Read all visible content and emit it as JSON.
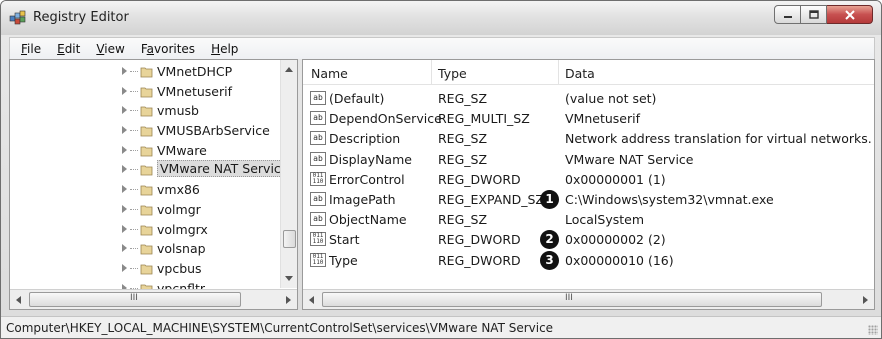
{
  "window": {
    "title": "Registry Editor",
    "icon": "registry-editor-icon",
    "buttons": {
      "minimize": "minimize-icon",
      "maximize": "maximize-icon",
      "close": "close-icon"
    }
  },
  "menu": [
    {
      "label": "File",
      "accel": "F",
      "rest": "ile"
    },
    {
      "label": "Edit",
      "accel": "E",
      "rest": "dit"
    },
    {
      "label": "View",
      "accel": "V",
      "rest": "iew"
    },
    {
      "label": "Favorites",
      "accel_before": "F",
      "accel": "a",
      "rest": "vorites"
    },
    {
      "label": "Help",
      "accel": "H",
      "rest": "elp"
    }
  ],
  "tree": {
    "items": [
      {
        "label": "VMnetDHCP"
      },
      {
        "label": "VMnetuserif"
      },
      {
        "label": "vmusb"
      },
      {
        "label": "VMUSBArbService"
      },
      {
        "label": "VMware"
      },
      {
        "label": "VMware NAT Servic",
        "selected": true
      },
      {
        "label": "vmx86"
      },
      {
        "label": "volmgr"
      },
      {
        "label": "volmgrx"
      },
      {
        "label": "volsnap"
      },
      {
        "label": "vpcbus"
      },
      {
        "label": "vpcnfltr"
      }
    ],
    "hscroll_grip": "III"
  },
  "list": {
    "columns": {
      "name": "Name",
      "type": "Type",
      "data": "Data"
    },
    "rows": [
      {
        "icon": "ab",
        "name": "(Default)",
        "type": "REG_SZ",
        "data": "(value not set)",
        "marker": ""
      },
      {
        "icon": "ab",
        "name": "DependOnService",
        "type": "REG_MULTI_SZ",
        "data": "VMnetuserif",
        "marker": ""
      },
      {
        "icon": "ab",
        "name": "Description",
        "type": "REG_SZ",
        "data": "Network address translation for virtual networks.",
        "marker": ""
      },
      {
        "icon": "ab",
        "name": "DisplayName",
        "type": "REG_SZ",
        "data": "VMware NAT Service",
        "marker": ""
      },
      {
        "icon": "bin",
        "name": "ErrorControl",
        "type": "REG_DWORD",
        "data": "0x00000001 (1)",
        "marker": ""
      },
      {
        "icon": "ab",
        "name": "ImagePath",
        "type": "REG_EXPAND_SZ",
        "data": "C:\\Windows\\system32\\vmnat.exe",
        "marker": "1"
      },
      {
        "icon": "ab",
        "name": "ObjectName",
        "type": "REG_SZ",
        "data": "LocalSystem",
        "marker": ""
      },
      {
        "icon": "bin",
        "name": "Start",
        "type": "REG_DWORD",
        "data": "0x00000002 (2)",
        "marker": "2"
      },
      {
        "icon": "bin",
        "name": "Type",
        "type": "REG_DWORD",
        "data": "0x00000010 (16)",
        "marker": "3"
      }
    ],
    "hscroll_grip": "III"
  },
  "status": {
    "path": "Computer\\HKEY_LOCAL_MACHINE\\SYSTEM\\CurrentControlSet\\services\\VMware NAT Service"
  }
}
